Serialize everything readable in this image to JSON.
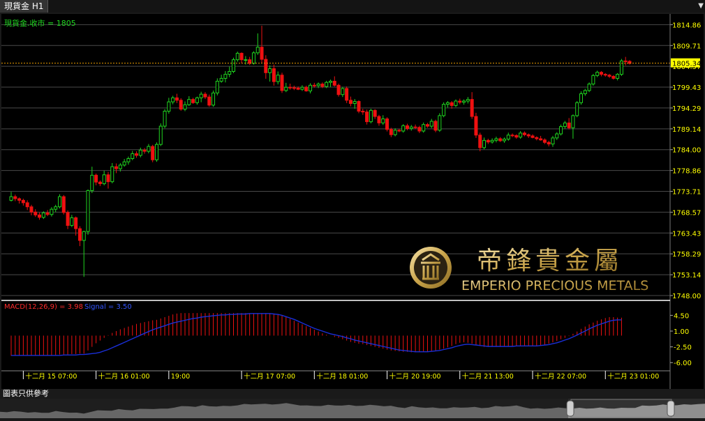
{
  "window": {
    "tab_title": "現貨金 H1"
  },
  "price_panel": {
    "label": "現貨金.收市 = 1805"
  },
  "macd_panel": {
    "label_macd": "MACD(12,26,9) = 3.98",
    "label_signal": "Signal = 3.50"
  },
  "footer": {
    "disclaimer": "圖表只供參考"
  },
  "watermark": {
    "brand_chinese": "帝鋒貴金屬",
    "brand_english": "EMPERIO PRECIOUS METALS"
  },
  "colors": {
    "up": "#1fd41f",
    "down": "#ee1111",
    "axis_text": "#ffff00",
    "grid": "#4a4a4a",
    "signal": "#1a2fd8",
    "price_line": "#f0a000"
  },
  "chart_data": {
    "type": "candlestick",
    "timeframe": "H1",
    "y_ticks": [
      1814.86,
      1809.71,
      1804.57,
      1799.43,
      1794.29,
      1789.14,
      1784.0,
      1778.86,
      1773.71,
      1768.57,
      1763.43,
      1758.29,
      1753.14,
      1748.0
    ],
    "ylim": [
      1748.0,
      1817.5
    ],
    "current_price": 1805.34,
    "current_price_label": "1805.34",
    "x_tick_labels": [
      "十二月 15 07:00",
      "十二月 16 01:00",
      "19:00",
      "十二月 17 07:00",
      "十二月 18 01:00",
      "十二月 20 19:00",
      "十二月 21 13:00",
      "十二月 22 07:00",
      "十二月 23 01:00"
    ],
    "x_tick_index": [
      3,
      21,
      39,
      57,
      75,
      93,
      111,
      129,
      147
    ],
    "candles": [
      [
        1771.5,
        1773.6,
        1771.2,
        1772.4
      ],
      [
        1772.4,
        1772.9,
        1771.3,
        1771.9
      ],
      [
        1771.9,
        1772.2,
        1770.7,
        1771.5
      ],
      [
        1771.5,
        1771.9,
        1770.2,
        1770.9
      ],
      [
        1770.9,
        1771.5,
        1769.1,
        1769.9
      ],
      [
        1769.9,
        1770.4,
        1767.8,
        1768.6
      ],
      [
        1768.6,
        1769.3,
        1767.4,
        1767.9
      ],
      [
        1767.9,
        1768.5,
        1766.7,
        1767.3
      ],
      [
        1767.3,
        1768.8,
        1766.9,
        1768.4
      ],
      [
        1768.4,
        1769.1,
        1767.6,
        1768.0
      ],
      [
        1768.0,
        1769.8,
        1767.5,
        1769.3
      ],
      [
        1769.3,
        1770.4,
        1768.6,
        1769.9
      ],
      [
        1769.9,
        1773.0,
        1769.5,
        1772.4
      ],
      [
        1772.4,
        1772.8,
        1768.0,
        1768.5
      ],
      [
        1768.5,
        1769.0,
        1764.4,
        1765.3
      ],
      [
        1765.3,
        1767.9,
        1764.9,
        1767.2
      ],
      [
        1767.2,
        1767.5,
        1762.8,
        1764.5
      ],
      [
        1764.5,
        1765.1,
        1760.2,
        1761.6
      ],
      [
        1761.6,
        1764.0,
        1752.6,
        1763.8
      ],
      [
        1763.8,
        1774.2,
        1763.0,
        1773.9
      ],
      [
        1773.9,
        1779.8,
        1773.3,
        1777.7
      ],
      [
        1777.7,
        1778.1,
        1775.2,
        1776.0
      ],
      [
        1776.0,
        1776.4,
        1775.0,
        1775.6
      ],
      [
        1775.6,
        1778.8,
        1775.2,
        1777.8
      ],
      [
        1777.8,
        1778.5,
        1774.4,
        1776.1
      ],
      [
        1776.1,
        1780.7,
        1775.7,
        1779.8
      ],
      [
        1779.8,
        1780.6,
        1778.2,
        1779.3
      ],
      [
        1779.3,
        1780.7,
        1778.6,
        1780.2
      ],
      [
        1780.2,
        1781.7,
        1779.8,
        1781.0
      ],
      [
        1781.0,
        1782.3,
        1780.3,
        1781.8
      ],
      [
        1781.8,
        1783.7,
        1781.4,
        1783.0
      ],
      [
        1783.0,
        1783.6,
        1782.0,
        1782.6
      ],
      [
        1782.6,
        1784.5,
        1782.1,
        1783.9
      ],
      [
        1783.9,
        1784.4,
        1783.0,
        1783.6
      ],
      [
        1783.6,
        1785.4,
        1783.1,
        1784.8
      ],
      [
        1784.8,
        1785.2,
        1780.9,
        1781.5
      ],
      [
        1781.5,
        1785.8,
        1781.0,
        1785.3
      ],
      [
        1785.3,
        1790.5,
        1784.9,
        1789.8
      ],
      [
        1789.8,
        1794.0,
        1789.3,
        1793.5
      ],
      [
        1793.5,
        1796.8,
        1792.9,
        1795.8
      ],
      [
        1795.8,
        1797.3,
        1795.2,
        1796.8
      ],
      [
        1796.8,
        1797.8,
        1795.5,
        1796.2
      ],
      [
        1796.2,
        1796.7,
        1793.6,
        1794.0
      ],
      [
        1794.0,
        1795.9,
        1793.5,
        1795.1
      ],
      [
        1795.1,
        1797.2,
        1794.8,
        1796.4
      ],
      [
        1796.4,
        1796.8,
        1795.3,
        1795.6
      ],
      [
        1795.6,
        1797.1,
        1795.1,
        1796.8
      ],
      [
        1796.8,
        1798.3,
        1795.7,
        1797.7
      ],
      [
        1797.7,
        1798.2,
        1796.5,
        1797.0
      ],
      [
        1797.0,
        1797.6,
        1794.6,
        1795.0
      ],
      [
        1795.0,
        1798.6,
        1794.6,
        1798.0
      ],
      [
        1798.0,
        1801.6,
        1797.4,
        1800.9
      ],
      [
        1800.9,
        1802.5,
        1800.5,
        1801.6
      ],
      [
        1801.6,
        1803.4,
        1800.6,
        1802.6
      ],
      [
        1802.6,
        1804.5,
        1801.9,
        1803.3
      ],
      [
        1803.3,
        1806.7,
        1802.9,
        1806.2
      ],
      [
        1806.2,
        1808.2,
        1805.7,
        1807.8
      ],
      [
        1807.8,
        1808.0,
        1805.3,
        1806.2
      ],
      [
        1806.2,
        1807.1,
        1805.0,
        1806.2
      ],
      [
        1806.2,
        1806.9,
        1804.9,
        1805.3
      ],
      [
        1805.3,
        1808.3,
        1805.0,
        1807.9
      ],
      [
        1807.9,
        1812.7,
        1807.4,
        1809.3
      ],
      [
        1809.3,
        1814.6,
        1805.3,
        1806.3
      ],
      [
        1806.3,
        1807.3,
        1801.5,
        1803.0
      ],
      [
        1803.0,
        1804.8,
        1800.8,
        1804.0
      ],
      [
        1804.0,
        1805.0,
        1799.8,
        1800.8
      ],
      [
        1800.8,
        1803.3,
        1800.1,
        1802.4
      ],
      [
        1802.4,
        1803.0,
        1798.0,
        1798.6
      ],
      [
        1798.6,
        1800.5,
        1798.2,
        1799.4
      ],
      [
        1799.4,
        1800.3,
        1798.8,
        1799.3
      ],
      [
        1799.3,
        1799.8,
        1798.7,
        1799.2
      ],
      [
        1799.2,
        1799.6,
        1798.7,
        1798.9
      ],
      [
        1798.9,
        1799.9,
        1798.5,
        1799.4
      ],
      [
        1799.4,
        1799.8,
        1798.3,
        1798.5
      ],
      [
        1798.5,
        1800.4,
        1797.9,
        1799.9
      ],
      [
        1799.9,
        1800.5,
        1799.3,
        1799.8
      ],
      [
        1799.8,
        1800.6,
        1799.2,
        1800.2
      ],
      [
        1800.2,
        1800.6,
        1799.2,
        1799.6
      ],
      [
        1799.6,
        1801.0,
        1799.2,
        1800.6
      ],
      [
        1800.6,
        1801.3,
        1799.5,
        1800.9
      ],
      [
        1800.9,
        1802.1,
        1799.6,
        1799.9
      ],
      [
        1799.9,
        1800.3,
        1797.1,
        1797.6
      ],
      [
        1797.6,
        1799.5,
        1797.0,
        1799.1
      ],
      [
        1799.1,
        1799.6,
        1795.5,
        1796.2
      ],
      [
        1796.2,
        1797.1,
        1794.7,
        1795.4
      ],
      [
        1795.4,
        1796.5,
        1794.1,
        1795.9
      ],
      [
        1795.9,
        1796.2,
        1793.0,
        1793.5
      ],
      [
        1793.5,
        1794.1,
        1792.6,
        1793.3
      ],
      [
        1793.3,
        1793.9,
        1790.2,
        1790.9
      ],
      [
        1790.9,
        1794.1,
        1790.5,
        1793.7
      ],
      [
        1793.7,
        1794.0,
        1791.6,
        1792.2
      ],
      [
        1792.2,
        1792.6,
        1789.9,
        1790.6
      ],
      [
        1790.6,
        1792.5,
        1790.1,
        1791.6
      ],
      [
        1791.6,
        1792.0,
        1788.5,
        1789.0
      ],
      [
        1789.0,
        1789.4,
        1787.1,
        1787.7
      ],
      [
        1787.7,
        1789.3,
        1787.3,
        1788.8
      ],
      [
        1788.8,
        1789.1,
        1788.3,
        1788.6
      ],
      [
        1788.6,
        1790.3,
        1788.2,
        1789.9
      ],
      [
        1789.9,
        1790.4,
        1788.8,
        1789.2
      ],
      [
        1789.2,
        1790.1,
        1788.7,
        1789.6
      ],
      [
        1789.6,
        1790.2,
        1789.1,
        1789.5
      ],
      [
        1789.5,
        1789.9,
        1788.1,
        1788.6
      ],
      [
        1788.6,
        1790.7,
        1788.2,
        1790.2
      ],
      [
        1790.2,
        1790.6,
        1789.4,
        1789.8
      ],
      [
        1789.8,
        1791.6,
        1789.3,
        1791.0
      ],
      [
        1791.0,
        1791.4,
        1788.3,
        1788.8
      ],
      [
        1788.8,
        1793.0,
        1788.4,
        1792.4
      ],
      [
        1792.4,
        1795.7,
        1792.0,
        1795.2
      ],
      [
        1795.2,
        1796.0,
        1794.4,
        1795.6
      ],
      [
        1795.6,
        1796.0,
        1794.1,
        1794.9
      ],
      [
        1794.9,
        1796.4,
        1794.5,
        1796.0
      ],
      [
        1796.0,
        1796.6,
        1795.2,
        1795.7
      ],
      [
        1795.7,
        1796.4,
        1795.1,
        1796.0
      ],
      [
        1796.0,
        1797.0,
        1795.4,
        1796.4
      ],
      [
        1796.4,
        1798.2,
        1791.6,
        1792.2
      ],
      [
        1792.2,
        1793.1,
        1786.9,
        1787.6
      ],
      [
        1787.6,
        1788.2,
        1783.6,
        1784.5
      ],
      [
        1784.5,
        1787.0,
        1784.1,
        1786.3
      ],
      [
        1786.3,
        1786.7,
        1785.4,
        1785.9
      ],
      [
        1785.9,
        1786.8,
        1785.5,
        1786.3
      ],
      [
        1786.3,
        1787.2,
        1785.8,
        1786.7
      ],
      [
        1786.7,
        1787.1,
        1785.9,
        1786.2
      ],
      [
        1786.2,
        1787.0,
        1785.7,
        1786.6
      ],
      [
        1786.6,
        1788.2,
        1786.2,
        1787.6
      ],
      [
        1787.6,
        1788.0,
        1787.1,
        1787.5
      ],
      [
        1787.5,
        1787.8,
        1786.7,
        1787.1
      ],
      [
        1787.1,
        1788.6,
        1786.7,
        1788.1
      ],
      [
        1788.1,
        1788.5,
        1787.3,
        1787.7
      ],
      [
        1787.7,
        1788.0,
        1786.9,
        1787.4
      ],
      [
        1787.4,
        1787.8,
        1786.8,
        1787.0
      ],
      [
        1787.0,
        1787.3,
        1786.3,
        1786.7
      ],
      [
        1786.7,
        1787.4,
        1786.2,
        1786.4
      ],
      [
        1786.4,
        1786.8,
        1785.4,
        1785.8
      ],
      [
        1785.8,
        1786.2,
        1784.8,
        1785.4
      ],
      [
        1785.4,
        1787.4,
        1784.7,
        1786.9
      ],
      [
        1786.9,
        1788.3,
        1786.4,
        1787.9
      ],
      [
        1787.9,
        1790.2,
        1787.5,
        1789.7
      ],
      [
        1789.7,
        1791.1,
        1789.2,
        1790.6
      ],
      [
        1790.6,
        1791.8,
        1789.0,
        1789.4
      ],
      [
        1789.4,
        1792.7,
        1786.7,
        1792.4
      ],
      [
        1792.4,
        1796.0,
        1792.0,
        1795.6
      ],
      [
        1795.6,
        1798.4,
        1795.1,
        1797.8
      ],
      [
        1797.8,
        1799.0,
        1797.3,
        1798.6
      ],
      [
        1798.6,
        1800.6,
        1798.2,
        1800.2
      ],
      [
        1800.2,
        1802.7,
        1799.8,
        1802.3
      ],
      [
        1802.3,
        1803.5,
        1801.9,
        1803.1
      ],
      [
        1803.1,
        1803.4,
        1802.1,
        1802.6
      ],
      [
        1802.6,
        1802.9,
        1802.0,
        1802.4
      ],
      [
        1802.4,
        1802.7,
        1801.7,
        1802.1
      ],
      [
        1802.1,
        1802.4,
        1801.3,
        1801.6
      ],
      [
        1801.6,
        1802.9,
        1801.1,
        1802.6
      ],
      [
        1802.6,
        1806.4,
        1802.2,
        1805.9
      ],
      [
        1805.9,
        1806.9,
        1804.8,
        1805.8
      ],
      [
        1805.8,
        1806.1,
        1805.0,
        1805.3
      ]
    ],
    "macd_ticks": [
      4.5,
      1.0,
      -2.5,
      -6.0
    ],
    "macd_ylim": [
      -7.2,
      5.8
    ],
    "macd_hist": [
      -4.5,
      -4.5,
      -4.4,
      -4.4,
      -4.4,
      -4.4,
      -4.4,
      -4.4,
      -4.4,
      -4.4,
      -4.4,
      -4.3,
      -4.2,
      -4.2,
      -4.2,
      -4.1,
      -4.1,
      -4.0,
      -4.0,
      -3.3,
      -2.5,
      -1.7,
      -1.1,
      -0.5,
      0.1,
      0.6,
      1.0,
      1.4,
      1.7,
      2.0,
      2.3,
      2.6,
      2.8,
      3.0,
      3.2,
      3.4,
      3.5,
      3.8,
      4.1,
      4.4,
      4.7,
      4.9,
      5.0,
      5.0,
      5.0,
      5.0,
      5.0,
      5.0,
      5.0,
      5.0,
      5.0,
      5.0,
      5.0,
      5.0,
      5.0,
      5.0,
      5.0,
      5.0,
      5.0,
      5.0,
      5.0,
      5.0,
      5.0,
      5.0,
      5.0,
      4.8,
      4.7,
      4.4,
      4.1,
      3.7,
      3.3,
      2.9,
      2.5,
      2.1,
      1.7,
      1.3,
      0.9,
      0.5,
      0.2,
      0.0,
      -0.3,
      -0.5,
      -0.8,
      -1.1,
      -1.4,
      -1.6,
      -1.8,
      -1.9,
      -2.1,
      -2.3,
      -2.5,
      -2.7,
      -2.9,
      -3.1,
      -3.3,
      -3.4,
      -3.5,
      -3.6,
      -3.6,
      -3.7,
      -3.7,
      -3.7,
      -3.6,
      -3.5,
      -3.4,
      -3.3,
      -3.1,
      -2.9,
      -2.6,
      -2.3,
      -1.9,
      -1.6,
      -1.5,
      -1.6,
      -1.8,
      -2.1,
      -2.3,
      -2.5,
      -2.5,
      -2.5,
      -2.5,
      -2.5,
      -2.4,
      -2.4,
      -2.3,
      -2.3,
      -2.3,
      -2.3,
      -2.3,
      -2.3,
      -2.3,
      -2.2,
      -2.0,
      -1.8,
      -1.5,
      -1.2,
      -0.8,
      -0.5,
      -0.1,
      0.4,
      0.9,
      1.5,
      2.0,
      2.5,
      2.9,
      3.3,
      3.6,
      3.9,
      4.1,
      4.1,
      4.0,
      3.98
    ],
    "macd_signal": [
      -4.4,
      -4.4,
      -4.4,
      -4.4,
      -4.4,
      -4.4,
      -4.4,
      -4.4,
      -4.4,
      -4.4,
      -4.4,
      -4.4,
      -4.4,
      -4.3,
      -4.3,
      -4.3,
      -4.3,
      -4.2,
      -4.2,
      -4.1,
      -4.0,
      -3.9,
      -3.7,
      -3.4,
      -3.1,
      -2.7,
      -2.3,
      -1.9,
      -1.5,
      -1.1,
      -0.7,
      -0.3,
      0.1,
      0.5,
      0.9,
      1.3,
      1.6,
      1.9,
      2.2,
      2.5,
      2.8,
      3.0,
      3.2,
      3.4,
      3.6,
      3.8,
      3.9,
      4.1,
      4.2,
      4.3,
      4.4,
      4.5,
      4.6,
      4.6,
      4.7,
      4.7,
      4.8,
      4.8,
      4.8,
      4.9,
      4.9,
      4.9,
      4.9,
      4.9,
      4.9,
      4.8,
      4.7,
      4.5,
      4.2,
      3.9,
      3.6,
      3.2,
      2.8,
      2.4,
      2.0,
      1.6,
      1.3,
      1.0,
      0.7,
      0.4,
      0.2,
      0.0,
      -0.2,
      -0.5,
      -0.7,
      -1.0,
      -1.2,
      -1.4,
      -1.6,
      -1.8,
      -2.0,
      -2.2,
      -2.4,
      -2.6,
      -2.8,
      -3.0,
      -3.2,
      -3.3,
      -3.4,
      -3.5,
      -3.6,
      -3.6,
      -3.6,
      -3.6,
      -3.5,
      -3.4,
      -3.3,
      -3.1,
      -2.9,
      -2.7,
      -2.4,
      -2.2,
      -2.0,
      -1.9,
      -2.0,
      -2.1,
      -2.2,
      -2.3,
      -2.4,
      -2.4,
      -2.4,
      -2.4,
      -2.4,
      -2.4,
      -2.4,
      -2.3,
      -2.3,
      -2.3,
      -2.3,
      -2.3,
      -2.3,
      -2.2,
      -2.1,
      -2.0,
      -1.8,
      -1.6,
      -1.3,
      -1.0,
      -0.7,
      -0.3,
      0.1,
      0.6,
      1.0,
      1.5,
      1.9,
      2.3,
      2.6,
      2.9,
      3.2,
      3.4,
      3.5,
      3.5
    ]
  }
}
